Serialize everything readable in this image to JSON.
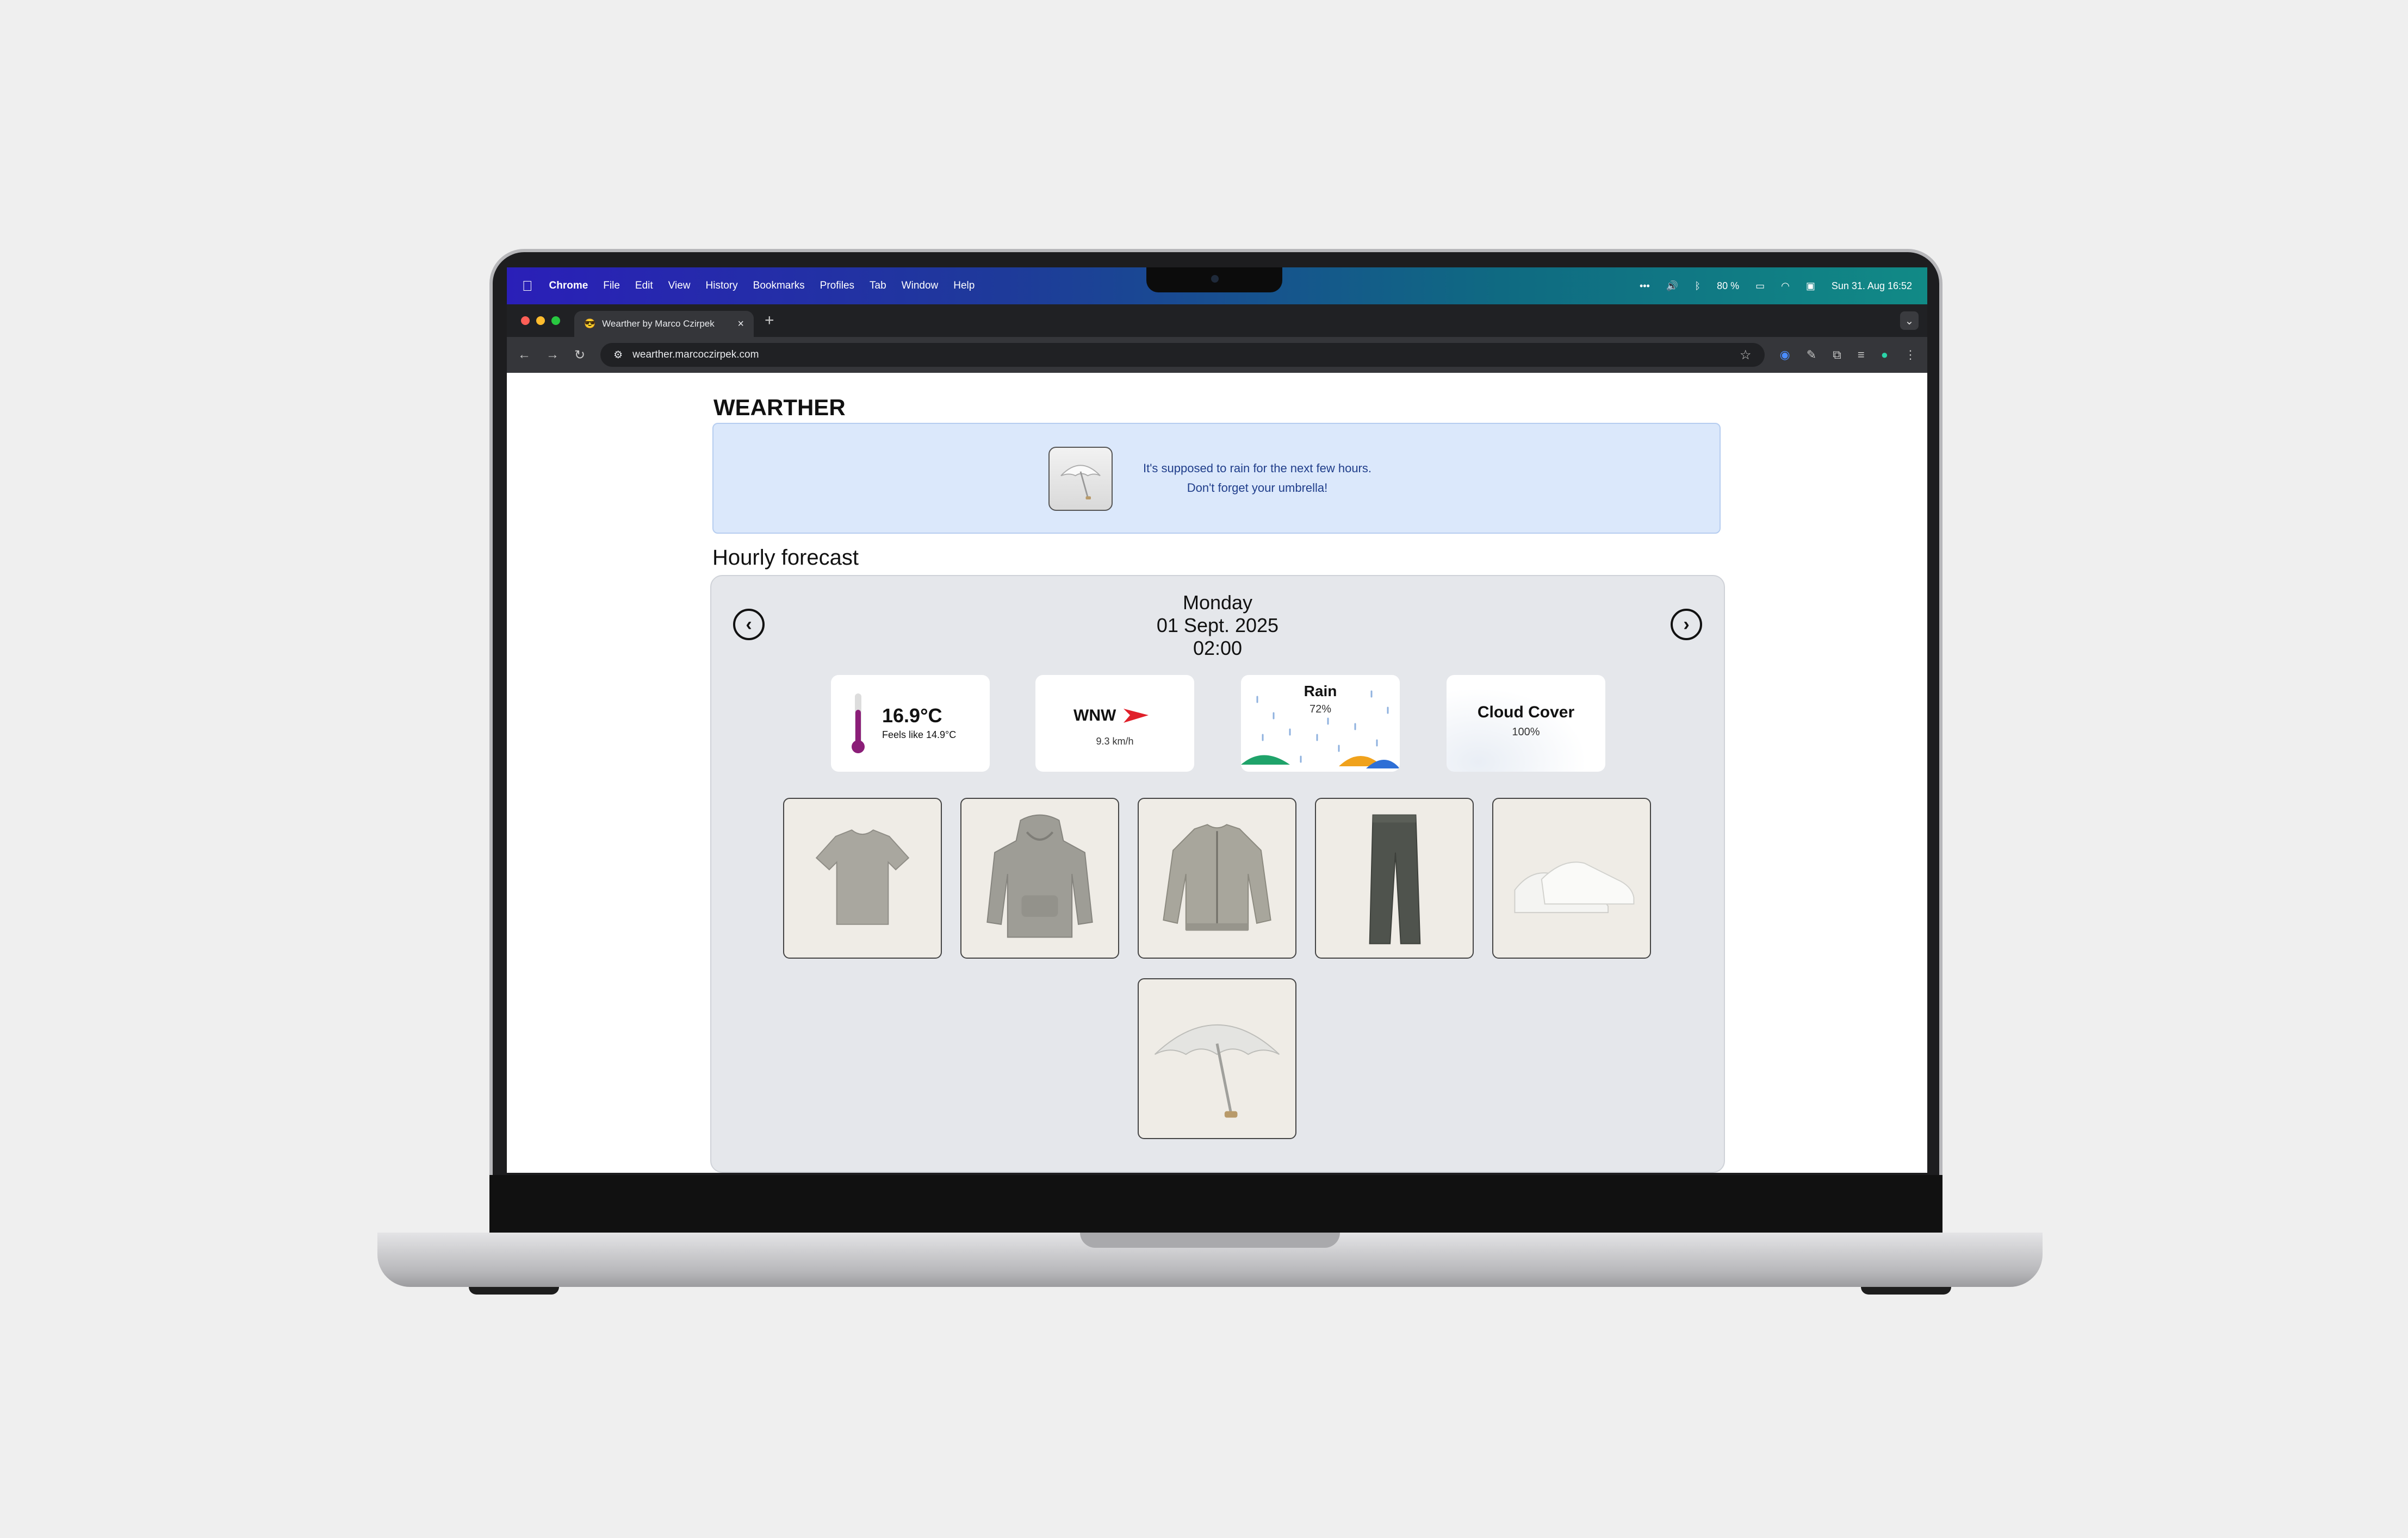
{
  "menubar": {
    "app": "Chrome",
    "items": [
      "File",
      "Edit",
      "View",
      "History",
      "Bookmarks",
      "Profiles",
      "Tab",
      "Window",
      "Help"
    ],
    "battery": "80 %",
    "datetime": "Sun 31. Aug 16:52"
  },
  "browser": {
    "tab_title": "Wearther by Marco Czirpek",
    "url": "wearther.marcoczirpek.com"
  },
  "app": {
    "title": "WEARTHER",
    "alert": {
      "line1": "It's supposed to rain for the next few hours.",
      "line2": "Don't forget your umbrella!"
    },
    "section_title": "Hourly forecast",
    "forecast": {
      "day": "Monday",
      "date": "01 Sept. 2025",
      "time": "02:00",
      "temperature": "16.9°C",
      "feels_like": "Feels like 14.9°C",
      "wind_direction": "WNW",
      "wind_speed": "9.3 km/h",
      "rain_label": "Rain",
      "rain_value": "72%",
      "cloud_label": "Cloud Cover",
      "cloud_value": "100%"
    },
    "outfit_items": [
      "t-shirt-icon",
      "hoodie-icon",
      "bomber-jacket-icon",
      "jeans-icon",
      "sneakers-icon",
      "umbrella-icon"
    ]
  },
  "colors": {
    "alert_bg": "#dbe8fb",
    "alert_text": "#1f3d8a",
    "forecast_bg": "#e5e7eb",
    "thermometer": "#8b1e78",
    "wind_arrow": "#e0202a"
  }
}
